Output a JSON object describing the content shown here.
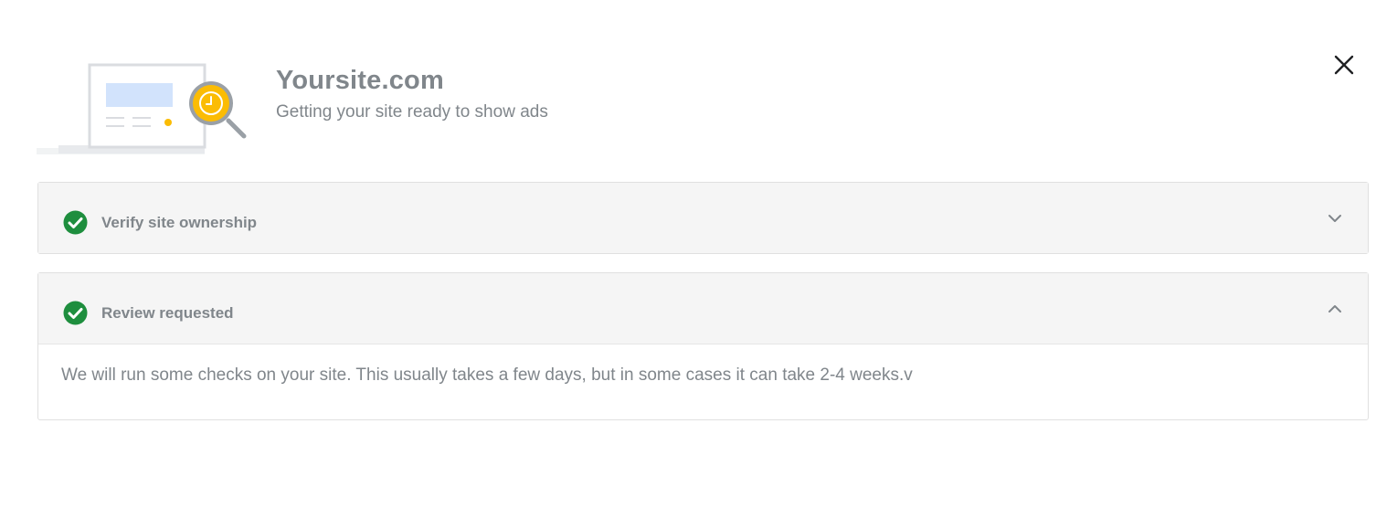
{
  "header": {
    "title": "Yoursite.com",
    "subtitle": "Getting your site ready to show ads",
    "illustration_icon": "site-review-magnifier-illustration"
  },
  "close_icon": "close-icon",
  "steps": [
    {
      "label": "Verify site ownership",
      "status": "complete",
      "status_icon": "check-circle-icon",
      "expanded": false,
      "toggle_icon": "chevron-down-icon"
    },
    {
      "label": "Review requested",
      "status": "complete",
      "status_icon": "check-circle-icon",
      "expanded": true,
      "toggle_icon": "chevron-up-icon",
      "body": "We will run some checks on your site. This usually takes a few days, but in some cases it can take 2-4 weeks.v"
    }
  ],
  "colors": {
    "success_green": "#1e8e3e",
    "accent_yellow": "#fbbc04",
    "text_gray": "#80868b",
    "panel_header_bg": "#f5f5f5"
  }
}
